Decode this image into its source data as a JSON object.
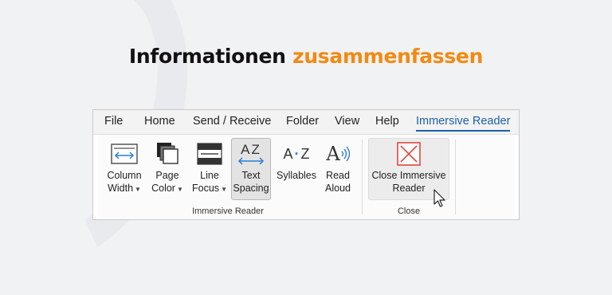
{
  "headline": {
    "part1": "Informationen",
    "part2": "zusammenfassen"
  },
  "menubar": {
    "items": [
      "File",
      "Home",
      "Send / Receive",
      "Folder",
      "View",
      "Help",
      "Immersive Reader"
    ],
    "active": "Immersive Reader"
  },
  "ribbon": {
    "buttons": [
      {
        "line1": "Column",
        "line2": "Width",
        "icon": "column-width-icon"
      },
      {
        "line1": "Page",
        "line2": "Color",
        "icon": "page-color-icon"
      },
      {
        "line1": "Line",
        "line2": "Focus",
        "icon": "line-focus-icon"
      },
      {
        "line1": "Text",
        "line2": "Spacing",
        "icon": "text-spacing-icon"
      },
      {
        "line1": "Syllables",
        "icon": "syllables-icon"
      },
      {
        "line1": "Read",
        "line2": "Aloud",
        "icon": "read-aloud-icon"
      },
      {
        "line1": "Close Immersive",
        "line2": "Reader",
        "icon": "close-x-icon"
      }
    ],
    "groups": [
      "Immersive Reader",
      "Close"
    ],
    "icon_text": {
      "text_spacing": "AZ",
      "syllables_a": "A",
      "syllables_dot": "·",
      "syllables_z": "Z",
      "read_aloud": "A"
    }
  },
  "colors": {
    "accent_orange": "#f18a12",
    "active_tab_blue": "#1d5fa8",
    "close_red": "#e0463c",
    "arrow_blue": "#2a7dd6"
  }
}
